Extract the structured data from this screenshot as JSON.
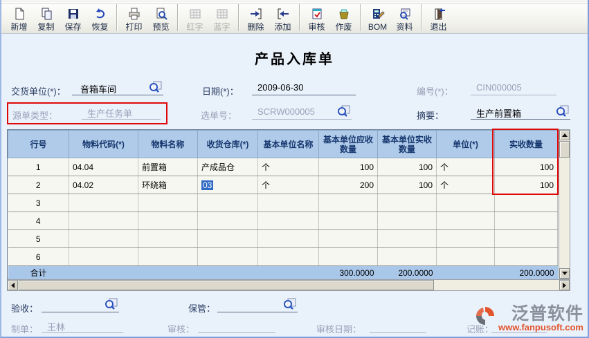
{
  "title": "产品入库单",
  "toolbar": {
    "buttons": [
      {
        "label": "新增",
        "icon": "new-document-icon",
        "enabled": true
      },
      {
        "label": "复制",
        "icon": "copy-icon",
        "enabled": true
      },
      {
        "label": "保存",
        "icon": "save-floppy-icon",
        "enabled": true
      },
      {
        "label": "恢复",
        "icon": "undo-icon",
        "enabled": true
      },
      {
        "label": "打印",
        "icon": "printer-icon",
        "enabled": true
      },
      {
        "label": "预览",
        "icon": "print-preview-icon",
        "enabled": true
      },
      {
        "label": "红字",
        "icon": "red-entry-grid-icon",
        "enabled": false
      },
      {
        "label": "蓝字",
        "icon": "blue-entry-grid-icon",
        "enabled": false
      },
      {
        "label": "删除",
        "icon": "delete-row-icon",
        "enabled": true
      },
      {
        "label": "添加",
        "icon": "add-row-icon",
        "enabled": true
      },
      {
        "label": "审核",
        "icon": "audit-icon",
        "enabled": true
      },
      {
        "label": "作废",
        "icon": "void-icon",
        "enabled": true
      },
      {
        "label": "BOM",
        "icon": "bom-icon",
        "enabled": true
      },
      {
        "label": "资料",
        "icon": "data-lookup-icon",
        "enabled": true
      },
      {
        "label": "退出",
        "icon": "exit-door-icon",
        "enabled": true
      }
    ]
  },
  "form": {
    "delivery_unit_label": "交货单位(*)：",
    "delivery_unit_value": "音箱车间",
    "date_label": "日期(*)：",
    "date_value": "2009-06-30",
    "doc_no_label": "编号(*)：",
    "doc_no_value": "CIN000005",
    "source_type_label": "源单类型：",
    "source_type_value": "生产任务单",
    "select_no_label": "选单号：",
    "select_no_value": "SCRW000005",
    "summary_label": "摘要：",
    "summary_value": "生产前置箱"
  },
  "table": {
    "headers": [
      "行号",
      "物料代码(*)",
      "物料名称",
      "收货仓库(*)",
      "基本单位名称",
      "基本单位应收数量",
      "基本单位实收数量",
      "单位(*)",
      "实收数量"
    ],
    "rows": [
      {
        "no": "1",
        "code": "04.04",
        "name": "前置箱",
        "warehouse": "产成品仓",
        "base_unit": "个",
        "due_qty": "100",
        "recv_qty": "100",
        "unit": "个",
        "actual_qty": "100"
      },
      {
        "no": "2",
        "code": "04.02",
        "name": "环绕箱",
        "warehouse": "03",
        "base_unit": "个",
        "due_qty": "200",
        "recv_qty": "100",
        "unit": "个",
        "actual_qty": "100"
      },
      {
        "no": "3",
        "code": "",
        "name": "",
        "warehouse": "",
        "base_unit": "",
        "due_qty": "",
        "recv_qty": "",
        "unit": "",
        "actual_qty": ""
      },
      {
        "no": "4",
        "code": "",
        "name": "",
        "warehouse": "",
        "base_unit": "",
        "due_qty": "",
        "recv_qty": "",
        "unit": "",
        "actual_qty": ""
      },
      {
        "no": "5",
        "code": "",
        "name": "",
        "warehouse": "",
        "base_unit": "",
        "due_qty": "",
        "recv_qty": "",
        "unit": "",
        "actual_qty": ""
      },
      {
        "no": "6",
        "code": "",
        "name": "",
        "warehouse": "",
        "base_unit": "",
        "due_qty": "",
        "recv_qty": "",
        "unit": "",
        "actual_qty": ""
      }
    ],
    "total_label": "合计",
    "total_due_qty": "300.0000",
    "total_recv_qty": "200.0000",
    "total_actual_qty": "200.0000"
  },
  "footer": {
    "inspect_label": "验收：",
    "keeper_label": "保管：",
    "maker_label": "制单：",
    "maker_value": "王林",
    "audit_label": "审核：",
    "audit_date_label": "审核日期：",
    "bookkeeping_label": "记账："
  },
  "logo": {
    "name": "泛普软件",
    "url": "www.fanpusoft.com"
  },
  "colors": {
    "annotation_red": "#e00909",
    "grid_header_blue": "#b0cbe9",
    "active_cell_yellow": "#ffffc8",
    "selection_blue": "#316ac5",
    "logo_orange": "#e2552d"
  }
}
